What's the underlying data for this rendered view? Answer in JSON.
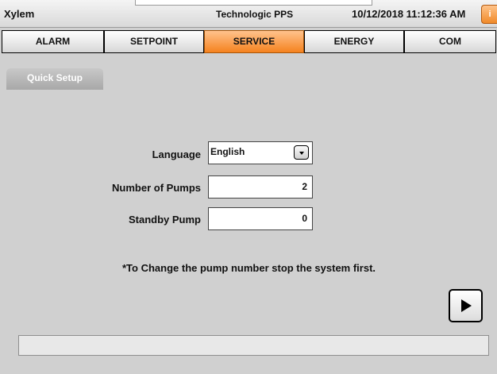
{
  "header": {
    "app_name": "Xylem",
    "product": "Technologic PPS",
    "datetime": "10/12/2018 11:12:36 AM",
    "info_label": "i"
  },
  "tabs": [
    {
      "label": "ALARM",
      "active": false
    },
    {
      "label": "SETPOINT",
      "active": false
    },
    {
      "label": "SERVICE",
      "active": true
    },
    {
      "label": "ENERGY",
      "active": false
    },
    {
      "label": "COM",
      "active": false
    }
  ],
  "subtab": {
    "label": "Quick Setup"
  },
  "form": {
    "language": {
      "label": "Language",
      "value": "English"
    },
    "num_pumps": {
      "label": "Number of Pumps",
      "value": "2"
    },
    "standby_pump": {
      "label": "Standby Pump",
      "value": "0"
    }
  },
  "note": "*To Change the pump number stop the system first.",
  "status": {
    "text": ""
  },
  "colors": {
    "accent": "#f5821f",
    "background": "#d0d0d0"
  },
  "icons": {
    "next": "play-icon",
    "dropdown": "chevron-down-icon"
  }
}
